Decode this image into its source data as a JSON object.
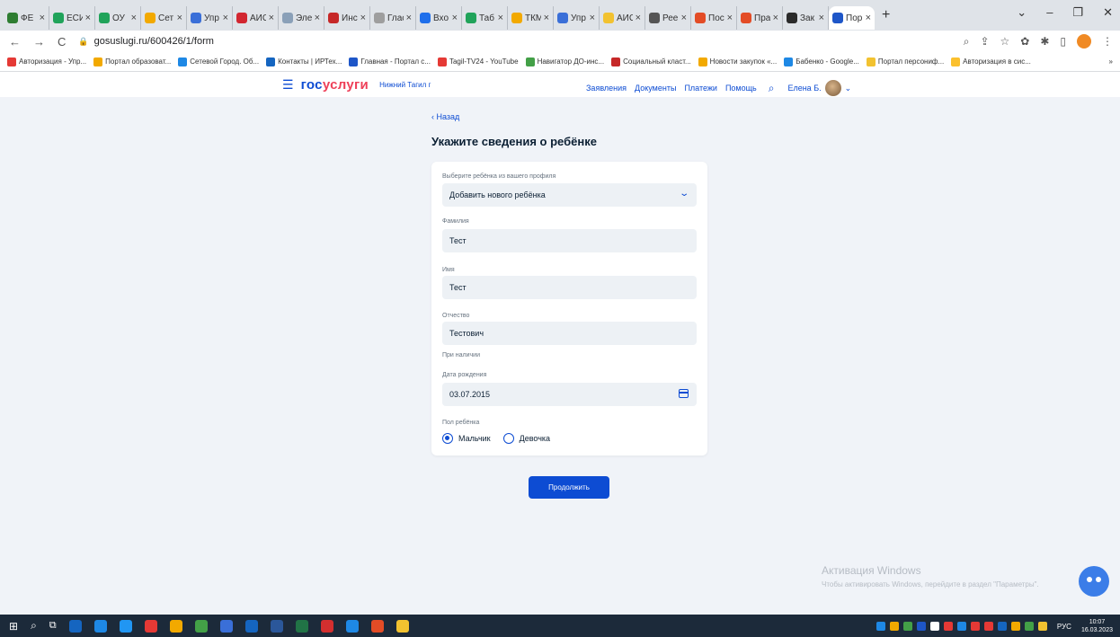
{
  "browser": {
    "tabs": [
      {
        "title": "ФЕ",
        "color": "#2e7d32"
      },
      {
        "title": "ЕСИ",
        "color": "#20a35a"
      },
      {
        "title": "ОУ",
        "color": "#20a35a"
      },
      {
        "title": "Сет",
        "color": "#f2a900"
      },
      {
        "title": "Упр",
        "color": "#3a6fd8"
      },
      {
        "title": "АИС",
        "color": "#d22630"
      },
      {
        "title": "Эле",
        "color": "#8aa0b8"
      },
      {
        "title": "Инс",
        "color": "#c62828"
      },
      {
        "title": "Глас",
        "color": "#9e9e9e"
      },
      {
        "title": "Вхо",
        "color": "#1f6feb"
      },
      {
        "title": "Таб",
        "color": "#20a35a"
      },
      {
        "title": "ТКМ",
        "color": "#f2a900"
      },
      {
        "title": "Упр",
        "color": "#3a6fd8"
      },
      {
        "title": "АИС",
        "color": "#f2c230"
      },
      {
        "title": "Рее",
        "color": "#555555"
      },
      {
        "title": "Пос",
        "color": "#e34c26"
      },
      {
        "title": "Пра",
        "color": "#e34c26"
      },
      {
        "title": "Зак",
        "color": "#2b2b2b"
      },
      {
        "title": "Пор",
        "color": "#1e56c8",
        "active": true
      }
    ],
    "new_tab": "+",
    "url": "gosuslugi.ru/600426/1/form",
    "bookmarks": [
      {
        "label": "Авторизация - Упр...",
        "color": "#e53935"
      },
      {
        "label": "Портал образоват...",
        "color": "#f2a900"
      },
      {
        "label": "Сетевой Город. Об...",
        "color": "#1e88e5"
      },
      {
        "label": "Контакты | ИРТех...",
        "color": "#1565c0"
      },
      {
        "label": "Главная - Портал с...",
        "color": "#1e56c8"
      },
      {
        "label": "Tagil-TV24 - YouTube",
        "color": "#e53935"
      },
      {
        "label": "Навигатор ДО-инс...",
        "color": "#43a047"
      },
      {
        "label": "Социальный класт...",
        "color": "#c62828"
      },
      {
        "label": "Новости закупок «...",
        "color": "#f2a900"
      },
      {
        "label": "Бабенко - Google...",
        "color": "#1e88e5"
      },
      {
        "label": "Портал персониф...",
        "color": "#f2c230"
      },
      {
        "label": "Авторизация в сис...",
        "color": "#fbc02d"
      }
    ],
    "bookmarks_more": "»"
  },
  "site": {
    "logo_part1": "гос",
    "logo_part2": "услуги",
    "city": "Нижний Тагил г",
    "nav": [
      "Заявления",
      "Документы",
      "Платежи",
      "Помощь"
    ],
    "user_name": "Елена Б."
  },
  "form": {
    "back": "‹ Назад",
    "title": "Укажите сведения о ребёнке",
    "profile_label": "Выберите ребёнка из вашего профиля",
    "profile_value": "Добавить нового ребёнка",
    "surname_label": "Фамилия",
    "surname_value": "Тест",
    "name_label": "Имя",
    "name_value": "Тест",
    "patronymic_label": "Отчество",
    "patronymic_value": "Тестович",
    "patronymic_hint": "При наличии",
    "birthdate_label": "Дата рождения",
    "birthdate_value": "03.07.2015",
    "gender_label": "Пол ребёнка",
    "gender_options": [
      "Мальчик",
      "Девочка"
    ],
    "gender_selected": "Мальчик",
    "submit": "Продолжить"
  },
  "watermark": {
    "title": "Активация Windows",
    "subtitle": "Чтобы активировать Windows, перейдите в раздел \"Параметры\"."
  },
  "taskbar": {
    "lang": "РУС",
    "time": "10:07",
    "date": "16.03.2023",
    "apps": [
      "#1565c0",
      "#1e88e5",
      "#2196f3",
      "#e53935",
      "#f2a900",
      "#43a047",
      "#3a6fd8",
      "#1565c0",
      "#2b579a",
      "#217346",
      "#d32f2f",
      "#1e88e5",
      "#e34c26",
      "#f2c230"
    ],
    "tray": [
      "#1e88e5",
      "#f2a900",
      "#43a047",
      "#1e56c8",
      "#ffffff",
      "#e53935",
      "#1e88e5",
      "#e53935",
      "#e53935",
      "#1565c0",
      "#f2a900",
      "#43a047",
      "#f2c230"
    ]
  }
}
